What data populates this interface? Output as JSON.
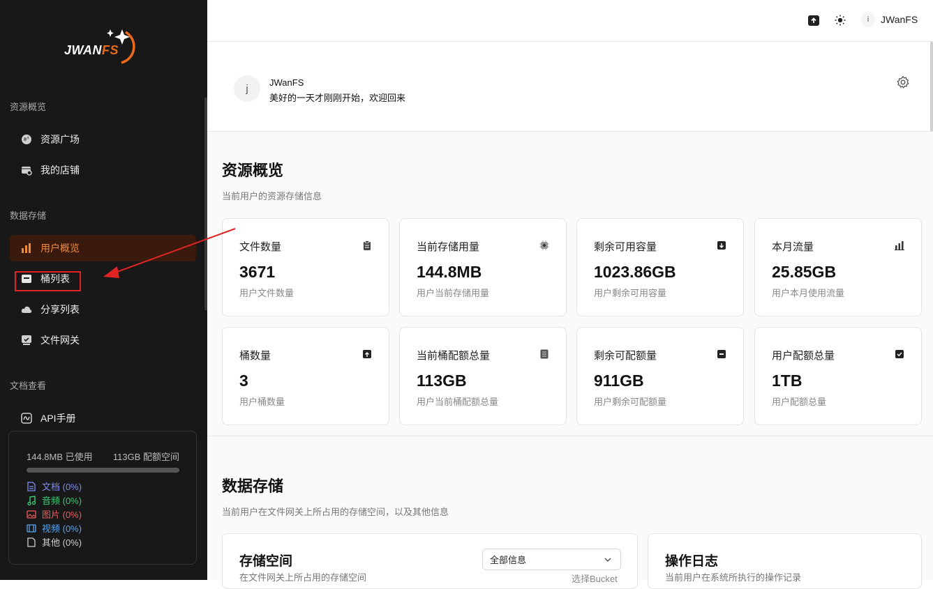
{
  "app": {
    "logo_main": "JWAN",
    "logo_accent": "FS"
  },
  "sidebar": {
    "sections": [
      {
        "title": "资源概览"
      },
      {
        "title": "数据存储"
      },
      {
        "title": "文档查看"
      }
    ],
    "items": [
      {
        "label": "资源广场",
        "icon": "globe-icon"
      },
      {
        "label": "我的店铺",
        "icon": "store-icon"
      },
      {
        "label": "用户概览",
        "icon": "bar-chart-icon",
        "active": true
      },
      {
        "label": "桶列表",
        "icon": "bucket-icon"
      },
      {
        "label": "分享列表",
        "icon": "cloud-share-icon"
      },
      {
        "label": "文件网关",
        "icon": "gateway-icon"
      },
      {
        "label": "API手册",
        "icon": "api-icon"
      }
    ],
    "storage": {
      "used": "144.8MB 已使用",
      "quota": "113GB 配额空间",
      "categories": [
        {
          "label": "文档 (0%)",
          "color": "#7f8cf0",
          "icon": "document-icon"
        },
        {
          "label": "音频 (0%)",
          "color": "#3cc97a",
          "icon": "music-icon"
        },
        {
          "label": "图片 (0%)",
          "color": "#ef5b5b",
          "icon": "image-icon"
        },
        {
          "label": "视频 (0%)",
          "color": "#5aa6f0",
          "icon": "film-icon"
        },
        {
          "label": "其他 (0%)",
          "color": "#cfcfcf",
          "icon": "file-icon"
        }
      ]
    }
  },
  "topbar": {
    "user_initial": "i",
    "user_name": "JWanFS"
  },
  "welcome": {
    "avatar_initial": "j",
    "name": "JWanFS",
    "message": "美好的一天才刚刚开始，欢迎回来"
  },
  "overview": {
    "title": "资源概览",
    "subtitle": "当前用户的资源存储信息",
    "cards": [
      {
        "title": "文件数量",
        "value": "3671",
        "desc": "用户文件数量",
        "icon": "clipboard-icon"
      },
      {
        "title": "当前存储用量",
        "value": "144.8MB",
        "desc": "用户当前存储用量",
        "icon": "chip-icon"
      },
      {
        "title": "剩余可用容量",
        "value": "1023.86GB",
        "desc": "用户剩余可用容量",
        "icon": "archive-down-icon"
      },
      {
        "title": "本月流量",
        "value": "25.85GB",
        "desc": "用户本月使用流量",
        "icon": "bar-chart-icon"
      },
      {
        "title": "桶数量",
        "value": "3",
        "desc": "用户桶数量",
        "icon": "archive-up-icon"
      },
      {
        "title": "当前桶配额总量",
        "value": "113GB",
        "desc": "用户当前桶配额总量",
        "icon": "list-icon"
      },
      {
        "title": "剩余可配额量",
        "value": "911GB",
        "desc": "用户剩余可配额量",
        "icon": "box-icon"
      },
      {
        "title": "用户配额总量",
        "value": "1TB",
        "desc": "用户配额总量",
        "icon": "archive-check-icon"
      }
    ]
  },
  "storage_section": {
    "title": "数据存储",
    "subtitle": "当前用户在文件网关上所占用的存储空间，以及其他信息",
    "space_card": {
      "title": "存储空间",
      "subtitle": "在文件网关上所占用的存储空间",
      "select_value": "全部信息",
      "select_hint": "选择Bucket"
    },
    "log_card": {
      "title": "操作日志",
      "subtitle": "当前用户在系统所执行的操作记录"
    }
  }
}
